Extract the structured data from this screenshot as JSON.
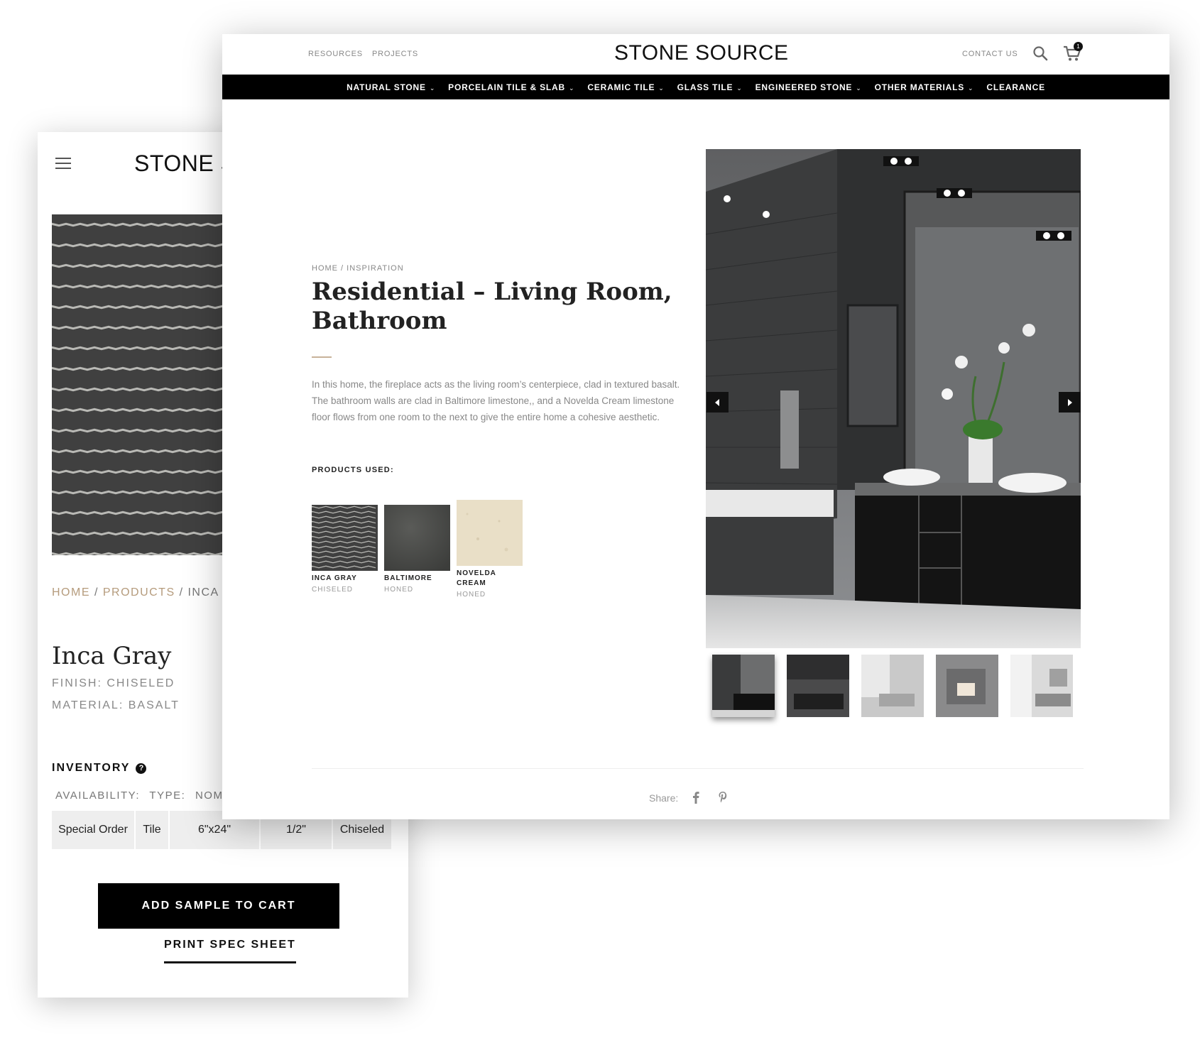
{
  "mobile": {
    "logo": "STONE S",
    "breadcrumb": {
      "home": "HOME",
      "sep1": " / ",
      "products": "PRODUCTS",
      "sep2": " / ",
      "current": "INCA G"
    },
    "title": "Inca Gray",
    "finish": "FINISH: CHISELED",
    "material": "MATERIAL: BASALT",
    "inventory_label": "INVENTORY",
    "help_glyph": "?",
    "columns": [
      "AVAILABILITY:",
      "TYPE:",
      "NOMINA"
    ],
    "row": [
      "Special Order",
      "Tile",
      "6\"x24\"",
      "1/2\"",
      "Chiseled"
    ],
    "add_sample": "ADD SAMPLE TO CART",
    "print_spec": "PRINT SPEC SHEET"
  },
  "desktop": {
    "top_links": {
      "resources": "RESOURCES",
      "projects": "PROJECTS",
      "contact": "CONTACT US"
    },
    "logo": "STONE SOURCE",
    "cart_count": "1",
    "nav": [
      {
        "label": "NATURAL STONE",
        "chevron": "⌄"
      },
      {
        "label": "PORCELAIN TILE & SLAB",
        "chevron": "⌄"
      },
      {
        "label": "CERAMIC TILE",
        "chevron": "⌄"
      },
      {
        "label": "GLASS TILE",
        "chevron": "⌄"
      },
      {
        "label": "ENGINEERED STONE",
        "chevron": "⌄"
      },
      {
        "label": "OTHER MATERIALS",
        "chevron": "⌄"
      },
      {
        "label": "CLEARANCE",
        "chevron": ""
      }
    ],
    "breadcrumb": "HOME / INSPIRATION",
    "title": "Residential – Living Room, Bathroom",
    "description": "In this home, the fireplace acts as the living room’s centerpiece, clad in textured basalt. The bathroom walls are clad in Baltimore limestone,, and a Novelda Cream limestone floor flows from one room to the next to give the entire home a cohesive aesthetic.",
    "products_used_label": "PRODUCTS USED:",
    "products": [
      {
        "name": "INCA GRAY",
        "finish": "CHISELED"
      },
      {
        "name": "BALTIMORE",
        "finish": "HONED"
      },
      {
        "name": "NOVELDA CREAM",
        "finish": "HONED"
      }
    ],
    "share_label": "Share:"
  },
  "colors": {
    "accent_gold": "#b59b7c",
    "nav_bg": "#000000",
    "button_bg": "#000000"
  }
}
